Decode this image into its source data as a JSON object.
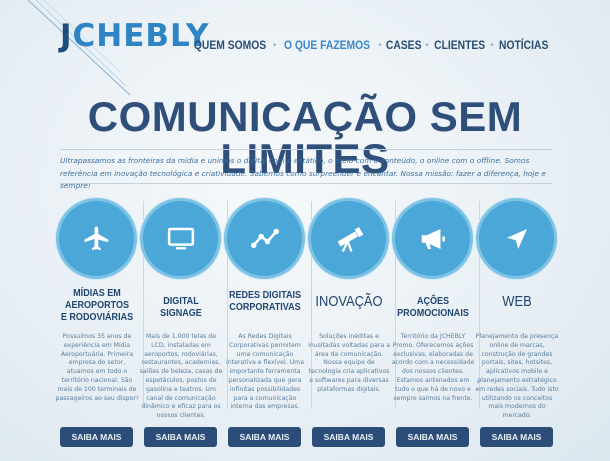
{
  "logo": {
    "text": "JCHEBLY",
    "first_letter": "J",
    "rest": "CHEBLY"
  },
  "nav": {
    "items": [
      {
        "label": "QUEM SOMOS",
        "active": false
      },
      {
        "label": "O QUE FAZEMOS",
        "active": true
      },
      {
        "label": "CASES",
        "active": false
      },
      {
        "label": "CLIENTES",
        "active": false
      },
      {
        "label": "NOTÍCIAS",
        "active": false
      }
    ],
    "separator": "•"
  },
  "headline": "COMUNICAÇÃO SEM LIMITES",
  "intro": "Ultrapassamos as fronteiras da mídia e unimos o digital com o estático, o meio com o conteúdo, o online com o offline. Somos referência em inovação tecnológica e criatividade. Sabemos como surpreender e encantar. Nossa missão: fazer a diferença, hoje e sempre!",
  "services": [
    {
      "icon": "airplane-icon",
      "title": "MÍDIAS EM AEROPORTOS E RODOVIÁRIAS",
      "text": "Possuímos 35 anos de experiência em Mídia Aeroportuária. Primeira empresa do setor, atuamos em todo o território nacional. São mais de 100 terminais de passageiros ao seu dispor!",
      "button": "SAIBA MAIS"
    },
    {
      "icon": "monitor-icon",
      "title": "DIGITAL SIGNAGE",
      "text": "Mais de 1.000 telas de LCD, instaladas em aeroportos, rodoviárias, restaurantes, academias, salões de beleza, casas de espetáculos, postos de gasolina e teatros. Um canal de comunicação dinâmico e eficaz para os nossos clientes.",
      "button": "SAIBA MAIS"
    },
    {
      "icon": "network-icon",
      "title": "REDES DIGITAIS CORPORATIVAS",
      "text": "As Redes Digitais Corporativas permitem uma comunicação interativa e flexível. Uma importante ferramenta personalizada que gera infinitas possibilidades para a comunicação interna das empresas.",
      "button": "SAIBA MAIS"
    },
    {
      "icon": "telescope-icon",
      "title": "INOVAÇÃO",
      "text": "Soluções inéditas e inusitadas voltadas para a área da comunicação. Nossa equipe de tecnologia cria aplicativos e softwares para diversas plataformas digitais.",
      "button": "SAIBA MAIS"
    },
    {
      "icon": "megaphone-icon",
      "title": "AÇÕES PROMOCIONAIS",
      "text": "Território da JCHEBLY Promo. Oferecemos ações exclusivas, elaboradas de acordo com a necessidade dos nossos clientes. Estamos antenados em tudo o que há de novo e sempre saímos na frente.",
      "button": "SAIBA MAIS"
    },
    {
      "icon": "cursor-arrow-icon",
      "title": "WEB",
      "text": "Planejamento da presença online de marcas, construção de grandes portais, sites, hotsites, aplicativos mobile e planejamento estratégico em redes sociais. Tudo isto utilizando os conceitos mais modernos do mercado.",
      "button": "SAIBA MAIS"
    }
  ],
  "colors": {
    "accent": "#4aa7d8",
    "navy": "#2c4d77",
    "logo_blue": "#2f84c4",
    "active_nav": "#3a86c8"
  }
}
